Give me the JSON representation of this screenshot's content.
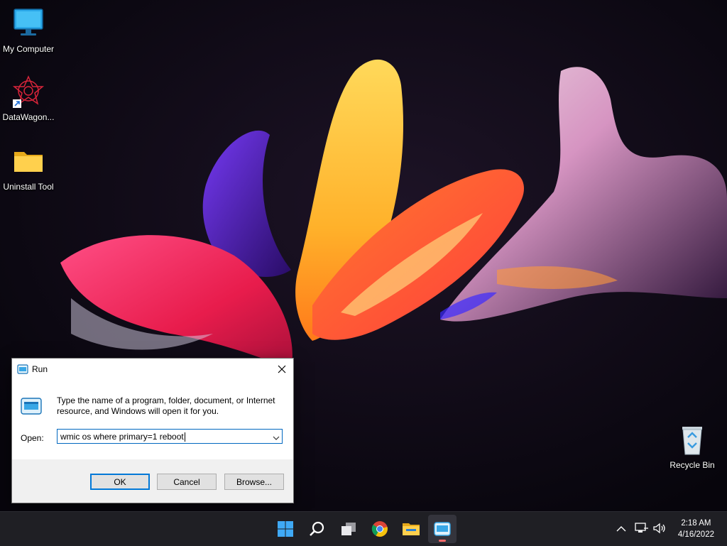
{
  "desktop": {
    "icons": [
      {
        "label": "My Computer"
      },
      {
        "label": "DataWagon..."
      },
      {
        "label": "Uninstall Tool"
      },
      {
        "label": "Recycle Bin"
      }
    ]
  },
  "run_dialog": {
    "title": "Run",
    "description": "Type the name of a program, folder, document, or Internet resource, and Windows will open it for you.",
    "open_label": "Open:",
    "open_value": "wmic os where primary=1 reboot",
    "buttons": {
      "ok": "OK",
      "cancel": "Cancel",
      "browse": "Browse..."
    }
  },
  "taskbar": {
    "apps": [
      "start-icon",
      "search-icon",
      "task-view-icon",
      "chrome-icon",
      "file-explorer-icon",
      "run-icon"
    ],
    "clock": {
      "time": "2:18 AM",
      "date": "4/16/2022"
    }
  },
  "colors": {
    "accent": "#0067c0",
    "taskbar": "#1f1f24"
  }
}
